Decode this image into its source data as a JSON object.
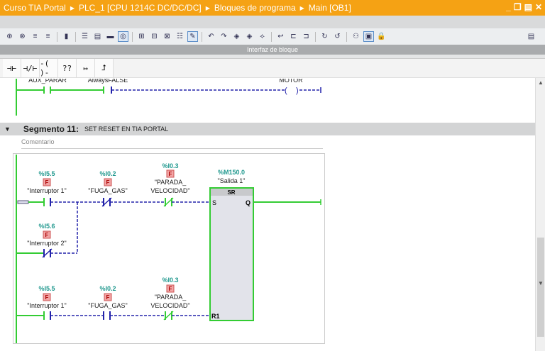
{
  "title": {
    "crumbs": [
      "Curso TIA Portal",
      "PLC_1 [CPU 1214C DC/DC/DC]",
      "Bloques de programa",
      "Main [OB1]"
    ],
    "window_buttons": [
      "_",
      "❐",
      "▤",
      "✕"
    ]
  },
  "toolbar": {
    "icons": [
      "insert-network-icon",
      "delete-network-icon",
      "insert-row-icon",
      "add-row-icon",
      "absolute-icon",
      "show-all-icon",
      "collapse-icon",
      "expand-icon",
      "comment-icon",
      "favorites-icon",
      "operand-icon",
      "symbol-icon",
      "list-icon",
      "info-icon",
      "go-to-error-icon",
      "go-to-error-next-icon",
      "monitor-icon",
      "monitor2-icon",
      "compare-icon",
      "open-block-icon",
      "call-icon",
      "call2-icon",
      "goto-icon",
      "goto2-icon",
      "user-icon",
      "monitoring-icon",
      "lock-icon"
    ],
    "right_icon": "split-editor-icon"
  },
  "interface_bar": "Interfaz de bloque",
  "instructions": [
    {
      "icon": "normally-open-contact-icon",
      "glyph": "⊣⊢"
    },
    {
      "icon": "normally-closed-contact-icon",
      "glyph": "⊣/⊢"
    },
    {
      "icon": "coil-icon",
      "glyph": "-( )-"
    },
    {
      "icon": "empty-box-icon",
      "glyph": "??"
    },
    {
      "icon": "open-branch-icon",
      "glyph": "↦"
    },
    {
      "icon": "close-branch-icon",
      "glyph": "⮥"
    }
  ],
  "prev_network": {
    "labels": [
      "AUX_PARAR",
      "AlwaysFALSE",
      "MOTOR"
    ]
  },
  "segment": {
    "title": "Segmento 11:",
    "name": "SET RESET EN TIA PORTAL",
    "comment": "Comentario"
  },
  "ladder": {
    "row1": [
      {
        "addr": "%I5.5",
        "name": "\"Interruptor 1\""
      },
      {
        "addr": "%I0.2",
        "name": "\"FUGA_GAS\""
      },
      {
        "addr": "%I0.3",
        "name1": "\"PARADA_",
        "name2": "VELOCIDAD\""
      }
    ],
    "row2": [
      {
        "addr": "%I5.6",
        "name": "\"Interruptor 2\""
      }
    ],
    "row3": [
      {
        "addr": "%I5.5",
        "name": "\"Interruptor 1\""
      },
      {
        "addr": "%I0.2",
        "name": "\"FUGA_GAS\""
      },
      {
        "addr": "%I0.3",
        "name1": "\"PARADA_",
        "name2": "VELOCIDAD\""
      }
    ],
    "block": {
      "addr": "%M150.0",
      "name": "\"Salida 1\"",
      "type": "SR",
      "set": "S",
      "reset": "R1",
      "out": "Q"
    },
    "f_badge": "F",
    "colors": {
      "energized": "#33cc33",
      "not_energized": "#2222aa"
    }
  }
}
